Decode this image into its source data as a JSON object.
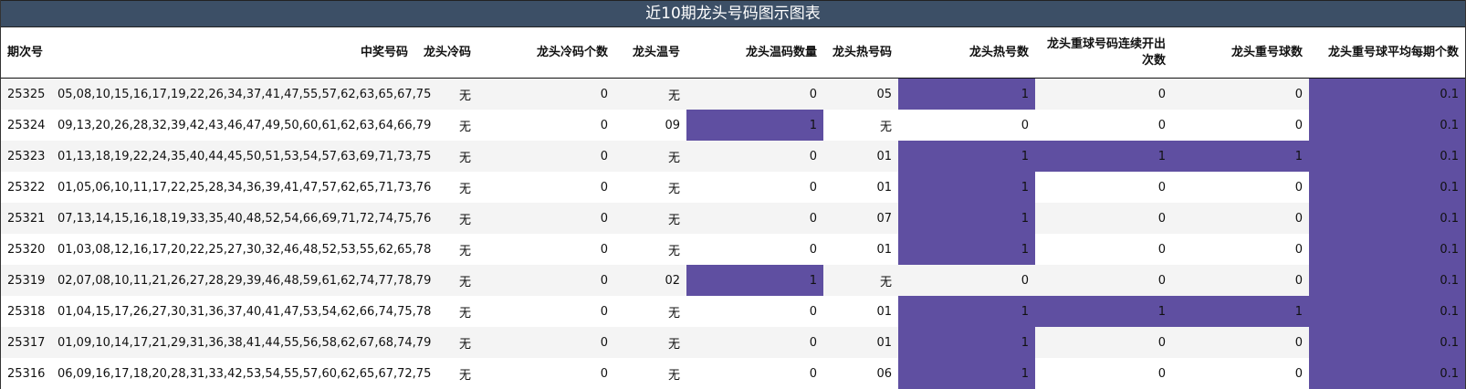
{
  "title": "近10期龙头号码图示图表",
  "headers": [
    "期次号",
    "中奖号码",
    "龙头冷码",
    "龙头冷码个数",
    "龙头温号",
    "龙头温码数量",
    "龙头热号码",
    "龙头热号数",
    "龙头重球号码连续开出次数",
    "龙头重号球数",
    "龙头重号球平均每期个数"
  ],
  "rows": [
    [
      "25325",
      "05,08,10,15,16,17,19,22,26,34,37,41,47,55,57,62,63,65,67,75",
      "无",
      "0",
      "无",
      "0",
      "05",
      "1",
      "0",
      "0",
      "0.1"
    ],
    [
      "25324",
      "09,13,20,26,28,32,39,42,43,46,47,49,50,60,61,62,63,64,66,79",
      "无",
      "0",
      "09",
      "1",
      "无",
      "0",
      "0",
      "0",
      "0.1"
    ],
    [
      "25323",
      "01,13,18,19,22,24,35,40,44,45,50,51,53,54,57,63,69,71,73,75",
      "无",
      "0",
      "无",
      "0",
      "01",
      "1",
      "1",
      "1",
      "0.1"
    ],
    [
      "25322",
      "01,05,06,10,11,17,22,25,28,34,36,39,41,47,57,62,65,71,73,76",
      "无",
      "0",
      "无",
      "0",
      "01",
      "1",
      "0",
      "0",
      "0.1"
    ],
    [
      "25321",
      "07,13,14,15,16,18,19,33,35,40,48,52,54,66,69,71,72,74,75,76",
      "无",
      "0",
      "无",
      "0",
      "07",
      "1",
      "0",
      "0",
      "0.1"
    ],
    [
      "25320",
      "01,03,08,12,16,17,20,22,25,27,30,32,46,48,52,53,55,62,65,78",
      "无",
      "0",
      "无",
      "0",
      "01",
      "1",
      "0",
      "0",
      "0.1"
    ],
    [
      "25319",
      "02,07,08,10,11,21,26,27,28,29,39,46,48,59,61,62,74,77,78,79",
      "无",
      "0",
      "02",
      "1",
      "无",
      "0",
      "0",
      "0",
      "0.1"
    ],
    [
      "25318",
      "01,04,15,17,26,27,30,31,36,37,40,41,47,53,54,62,66,74,75,78",
      "无",
      "0",
      "无",
      "0",
      "01",
      "1",
      "1",
      "1",
      "0.1"
    ],
    [
      "25317",
      "01,09,10,14,17,21,29,31,36,38,41,44,55,56,58,62,67,68,74,79",
      "无",
      "0",
      "无",
      "0",
      "01",
      "1",
      "0",
      "0",
      "0.1"
    ],
    [
      "25316",
      "06,09,16,17,18,20,28,31,33,42,53,54,55,57,60,62,65,67,72,75",
      "无",
      "0",
      "无",
      "0",
      "06",
      "1",
      "0",
      "0",
      "0.1"
    ]
  ],
  "highlight_color": "#5f4fa1",
  "title_bar_color": "#3c4f66"
}
